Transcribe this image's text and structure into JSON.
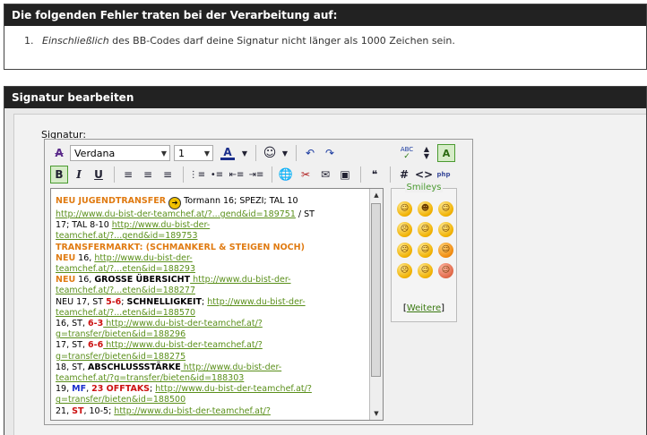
{
  "error": {
    "title": "Die folgenden Fehler traten bei der Verarbeitung auf:",
    "items": [
      {
        "num": "1.",
        "emph": "Einschließlich",
        "text": " des BB-Codes darf deine Signatur nicht länger als 1000 Zeichen sein."
      }
    ]
  },
  "signature": {
    "title": "Signatur bearbeiten",
    "label": "Signatur:"
  },
  "toolbar": {
    "font": "Verdana",
    "size": "1",
    "bold": "B",
    "italic": "I",
    "underline": "U"
  },
  "content": {
    "l1a": "NEU JUGENDTRANSFER",
    "l1b": " Tormann 16; SPEZI; TAL 10",
    "l2a": "http://www.du-bist-der-teamchef.at/?...gend&id=189751",
    "l2b": " / ST",
    "l3": "17; TAL 8-10 ",
    "l3link": "http://www.du-bist-der-",
    "l4": "teamchef.at/?...gend&id=189753",
    "l5": "TRANSFERMARKT: (SCHMANKERL & STEIGEN NOCH)",
    "l6a": "NEU",
    "l6b": " 16, ",
    "l6link": "http://www.du-bist-der-",
    "l7": "teamchef.at/?...eten&id=188293",
    "l8a": "NEU",
    "l8b": " 16, ",
    "l8c": "GROSSE ÜBERSICHT",
    "l8link": " http://www.du-bist-der-",
    "l9": "teamchef.at/?...eten&id=188277",
    "l10a": "NEU 17, ST ",
    "l10b": "5-6",
    "l10c": "; ",
    "l10d": "SCHNELLIGKEIT",
    "l10e": "; ",
    "l10link": "http://www.du-bist-der-",
    "l11": "teamchef.at/?...eten&id=188570",
    "l12a": "16, ST, ",
    "l12b": "6-3",
    "l12link": " http://www.du-bist-der-teamchef.at/?",
    "l13": "g=transfer/bieten&id=188296",
    "l14a": "17, ST, ",
    "l14b": "6-6",
    "l14link": " http://www.du-bist-der-teamchef.at/?",
    "l15": "g=transfer/bieten&id=188275",
    "l16a": "18, ST, ",
    "l16b": "ABSCHLUSSSTÄRKE",
    "l16link": " http://www.du-bist-der-",
    "l17": "teamchef.at/?g=transfer/bieten&id=188303",
    "l18a": "19, ",
    "l18b": "MF",
    "l18c": ", ",
    "l18d": "23 OFFTAKS",
    "l18e": "; ",
    "l18link": "http://www.du-bist-der-teamchef.at/?",
    "l19": "g=transfer/bieten&id=188500",
    "l20a": "21, ",
    "l20b": "ST",
    "l20c": ", 10-5; ",
    "l20link": "http://www.du-bist-der-teamchef.at/?"
  },
  "smileys": {
    "title": "Smileys",
    "more_open": "[",
    "more_link": "Weitere",
    "more_close": "]",
    "faces": [
      "☺",
      "☻",
      "☺",
      "☹",
      "☺",
      "☺",
      "☹",
      "☺",
      "☺",
      "☹",
      "☺",
      "☺"
    ]
  },
  "colors": {
    "header_bg": "#222222",
    "link": "#5a8f1a",
    "highlight_orange": "#e07b12",
    "highlight_red": "#cc1111",
    "highlight_blue": "#1a2ecc"
  }
}
